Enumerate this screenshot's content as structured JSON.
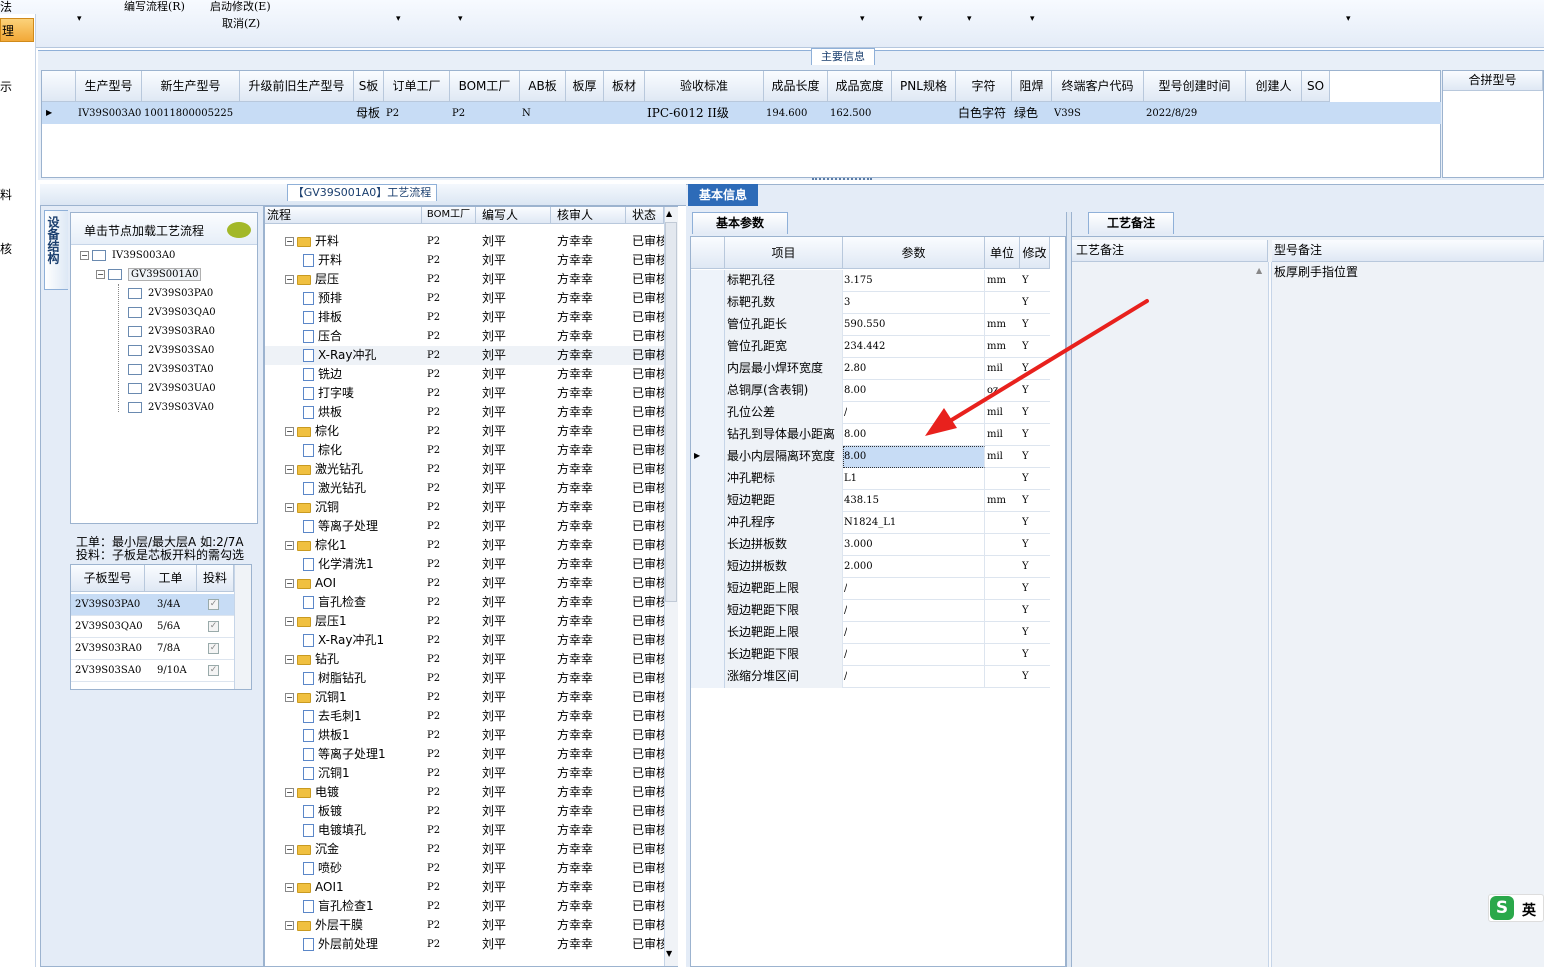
{
  "toolbar": {
    "left_partial": "法",
    "edit_flow": "编写流程(R)",
    "start_modify": "启动修改(E)",
    "cancel": "取消(Z)",
    "dropdown_arrow": "▾"
  },
  "left_strip": [
    "理",
    "示",
    "料",
    "核"
  ],
  "main_info": {
    "title": "主要信息",
    "columns": [
      "生产型号",
      "新生产型号",
      "升级前旧生产型号",
      "S板",
      "订单工厂",
      "BOM工厂",
      "AB板",
      "板厚",
      "板材",
      "验收标准",
      "成品长度",
      "成品宽度",
      "PNL规格",
      "字符",
      "阻焊",
      "终端客户代码",
      "型号创建时间",
      "创建人",
      "SO"
    ],
    "row": [
      "IV39S003A0",
      "10011800005225",
      "",
      "母板",
      "P2",
      "P2",
      "N",
      "",
      "",
      "IPC-6012 II级",
      "194.600",
      "162.500",
      "",
      "白色字符",
      "绿色",
      "V39S",
      "2022/8/29",
      "",
      ""
    ],
    "merge_header": "合拼型号"
  },
  "left_panel": {
    "vertical_tab": "设备结构",
    "load_hint": "单击节点加载工艺流程",
    "tree_root": "IV39S003A0",
    "tree_child": "GV39S001A0",
    "tree_leaves": [
      "2V39S03PA0",
      "2V39S03QA0",
      "2V39S03RA0",
      "2V39S03SA0",
      "2V39S03TA0",
      "2V39S03UA0",
      "2V39S03VA0"
    ],
    "note1": "工单：最小层/最大层A 如:2/7A",
    "note2": "投料：子板是芯板开料的需勾选",
    "sub_columns": [
      "子板型号",
      "工单",
      "投料"
    ],
    "sub_rows": [
      {
        "model": "2V39S03PA0",
        "order": "3/4A"
      },
      {
        "model": "2V39S03QA0",
        "order": "5/6A"
      },
      {
        "model": "2V39S03RA0",
        "order": "7/8A"
      },
      {
        "model": "2V39S03SA0",
        "order": "9/10A"
      }
    ],
    "check_mark": "✓"
  },
  "flow": {
    "title": "【GV39S001A0】工艺流程",
    "columns": [
      "流程",
      "BOM工厂",
      "编写人",
      "核审人",
      "状态"
    ],
    "factory": "P2",
    "writer": "刘平",
    "reviewer": "方幸幸",
    "status": "已审核",
    "rows": [
      {
        "name": "开料",
        "folder": true
      },
      {
        "name": "开料",
        "folder": false
      },
      {
        "name": "层压",
        "folder": true
      },
      {
        "name": "预排",
        "folder": false
      },
      {
        "name": "排板",
        "folder": false
      },
      {
        "name": "压合",
        "folder": false
      },
      {
        "name": "X-Ray冲孔",
        "folder": false
      },
      {
        "name": "铣边",
        "folder": false
      },
      {
        "name": "打字唛",
        "folder": false
      },
      {
        "name": "烘板",
        "folder": false
      },
      {
        "name": "棕化",
        "folder": true
      },
      {
        "name": "棕化",
        "folder": false
      },
      {
        "name": "激光钻孔",
        "folder": true
      },
      {
        "name": "激光钻孔",
        "folder": false
      },
      {
        "name": "沉铜",
        "folder": true
      },
      {
        "name": "等离子处理",
        "folder": false
      },
      {
        "name": "棕化1",
        "folder": true
      },
      {
        "name": "化学清洗1",
        "folder": false
      },
      {
        "name": "AOI",
        "folder": true
      },
      {
        "name": "盲孔检查",
        "folder": false
      },
      {
        "name": "层压1",
        "folder": true
      },
      {
        "name": "X-Ray冲孔1",
        "folder": false
      },
      {
        "name": "钻孔",
        "folder": true
      },
      {
        "name": "树脂钻孔",
        "folder": false
      },
      {
        "name": "沉铜1",
        "folder": true
      },
      {
        "name": "去毛刺1",
        "folder": false
      },
      {
        "name": "烘板1",
        "folder": false
      },
      {
        "name": "等离子处理1",
        "folder": false
      },
      {
        "name": "沉铜1",
        "folder": false
      },
      {
        "name": "电镀",
        "folder": true
      },
      {
        "name": "板镀",
        "folder": false
      },
      {
        "name": "电镀填孔",
        "folder": false
      },
      {
        "name": "沉金",
        "folder": true
      },
      {
        "name": "喷砂",
        "folder": false
      },
      {
        "name": "AOI1",
        "folder": true
      },
      {
        "name": "盲孔检查1",
        "folder": false
      },
      {
        "name": "外层干膜",
        "folder": true
      },
      {
        "name": "外层前处理",
        "folder": false
      }
    ]
  },
  "basic_info": {
    "tab": "基本信息",
    "sub_tab": "基本参数",
    "columns": [
      "项目",
      "参数",
      "单位",
      "修改"
    ],
    "rows": [
      {
        "item": "标靶孔径",
        "value": "3.175",
        "unit": "mm",
        "mod": "Y"
      },
      {
        "item": "标靶孔数",
        "value": "3",
        "unit": "",
        "mod": "Y"
      },
      {
        "item": "管位孔距长",
        "value": "590.550",
        "unit": "mm",
        "mod": "Y"
      },
      {
        "item": "管位孔距宽",
        "value": "234.442",
        "unit": "mm",
        "mod": "Y"
      },
      {
        "item": "内层最小焊环宽度",
        "value": "2.80",
        "unit": "mil",
        "mod": "Y"
      },
      {
        "item": "总铜厚(含表铜)",
        "value": "8.00",
        "unit": "oz",
        "mod": "Y"
      },
      {
        "item": "孔位公差",
        "value": "/",
        "unit": "mil",
        "mod": "Y"
      },
      {
        "item": "钻孔到导体最小距离",
        "value": "8.00",
        "unit": "mil",
        "mod": "Y"
      },
      {
        "item": "最小内层隔离环宽度",
        "value": "8.00",
        "unit": "mil",
        "mod": "Y"
      },
      {
        "item": "冲孔靶标",
        "value": "L1",
        "unit": "",
        "mod": "Y"
      },
      {
        "item": "短边靶距",
        "value": "438.15",
        "unit": "mm",
        "mod": "Y"
      },
      {
        "item": "冲孔程序",
        "value": "N1824_L1",
        "unit": "",
        "mod": "Y"
      },
      {
        "item": "长边拼板数",
        "value": "3.000",
        "unit": "",
        "mod": "Y"
      },
      {
        "item": "短边拼板数",
        "value": "2.000",
        "unit": "",
        "mod": "Y"
      },
      {
        "item": "短边靶距上限",
        "value": "/",
        "unit": "",
        "mod": "Y"
      },
      {
        "item": "短边靶距下限",
        "value": "/",
        "unit": "",
        "mod": "Y"
      },
      {
        "item": "长边靶距上限",
        "value": "/",
        "unit": "",
        "mod": "Y"
      },
      {
        "item": "长边靶距下限",
        "value": "/",
        "unit": "",
        "mod": "Y"
      },
      {
        "item": "涨缩分堆区间",
        "value": "/",
        "unit": "",
        "mod": "Y"
      }
    ]
  },
  "process_notes": {
    "tab": "工艺备注",
    "col1": "工艺备注",
    "col2": "型号备注",
    "model_note": "板厚刷手指位置"
  },
  "ime": {
    "label": "英"
  },
  "colors": {
    "selected_row": "#c7dcf5",
    "tab_active": "#2d6bb8",
    "arrow": "#e8211d"
  }
}
